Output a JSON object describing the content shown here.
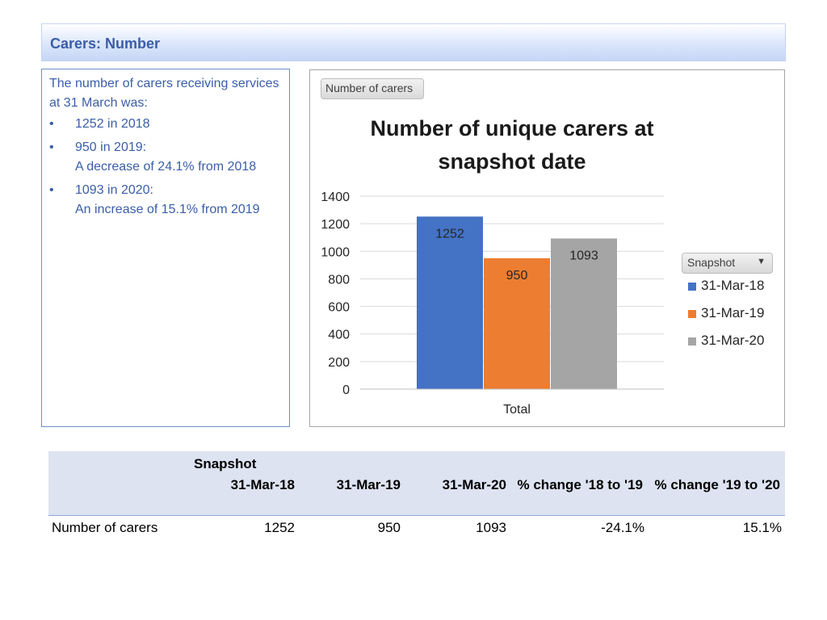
{
  "header": {
    "title": "Carers: Number"
  },
  "summary": {
    "intro": "The number of carers receiving services at 31 March was:",
    "bullets": [
      {
        "line1": "1252 in 2018",
        "line2": ""
      },
      {
        "line1": "950 in 2019:",
        "line2": "A decrease of 24.1% from 2018"
      },
      {
        "line1": "1093 in 2020:",
        "line2": "An increase of 15.1%  from 2019"
      }
    ]
  },
  "pivot": {
    "field_button": "Number of carers",
    "legend_button": "Snapshot",
    "legend_arrow": "▼"
  },
  "chart_data": {
    "type": "bar",
    "title_line1": "Number of unique carers at",
    "title_line2": "snapshot date",
    "categories": [
      "Total"
    ],
    "series": [
      {
        "name": "31-Mar-18",
        "values": [
          1252
        ],
        "color": "#4472c4"
      },
      {
        "name": "31-Mar-19",
        "values": [
          950
        ],
        "color": "#ed7d31"
      },
      {
        "name": "31-Mar-20",
        "values": [
          1093
        ],
        "color": "#a5a5a5"
      }
    ],
    "ylim": [
      0,
      1400
    ],
    "yticks": [
      0,
      200,
      400,
      600,
      800,
      1000,
      1200,
      1400
    ],
    "grid": true,
    "legend_position": "right"
  },
  "table": {
    "group_header": "Snapshot",
    "columns": [
      "31-Mar-18",
      "31-Mar-19",
      "31-Mar-20",
      "% change '18 to '19",
      "% change '19 to '20"
    ],
    "rows": [
      {
        "label": "Number of carers",
        "values": [
          "1252",
          "950",
          "1093",
          "-24.1%",
          "15.1%"
        ]
      }
    ]
  }
}
